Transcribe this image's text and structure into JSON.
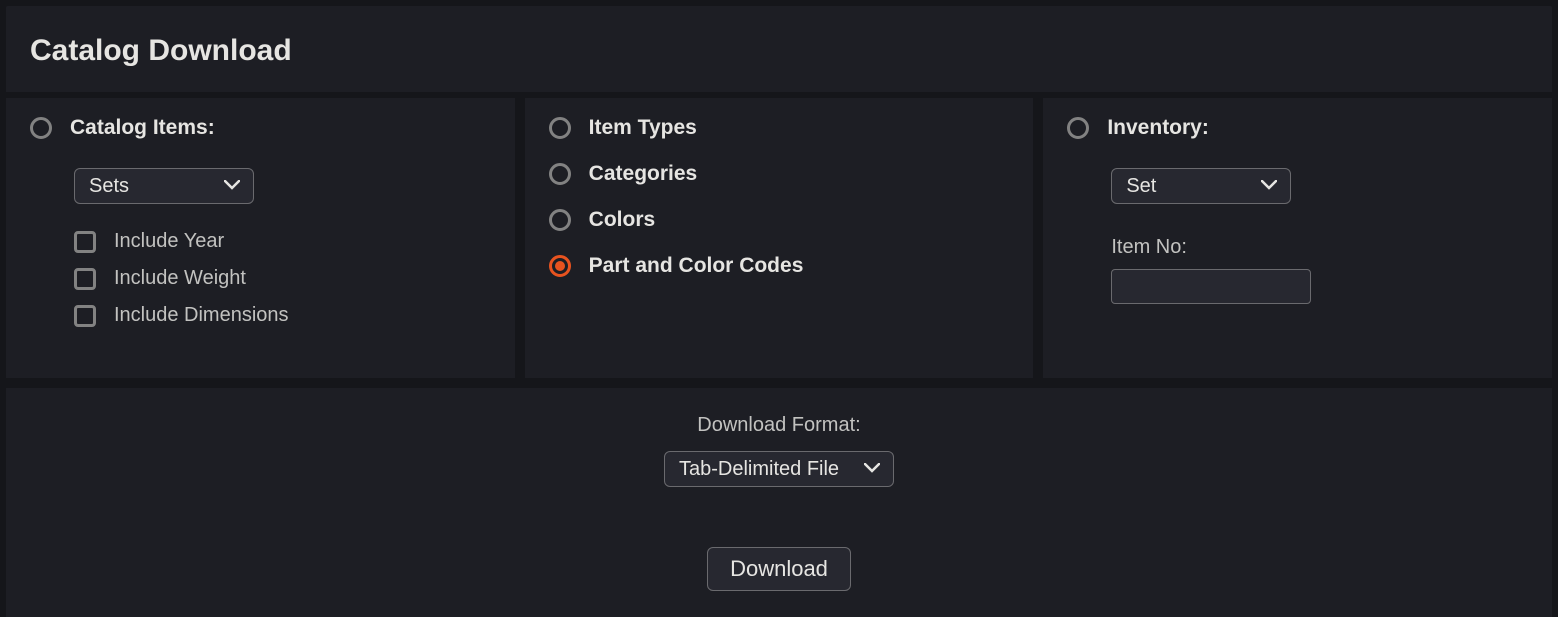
{
  "header": {
    "title": "Catalog Download"
  },
  "col1": {
    "radio_label": "Catalog Items:",
    "radio_selected": false,
    "select_value": "Sets",
    "checkboxes": [
      {
        "label": "Include Year",
        "checked": false
      },
      {
        "label": "Include Weight",
        "checked": false
      },
      {
        "label": "Include Dimensions",
        "checked": false
      }
    ]
  },
  "col2": {
    "options": [
      {
        "label": "Item Types",
        "selected": false
      },
      {
        "label": "Categories",
        "selected": false
      },
      {
        "label": "Colors",
        "selected": false
      },
      {
        "label": "Part and Color Codes",
        "selected": true
      }
    ]
  },
  "col3": {
    "radio_label": "Inventory:",
    "radio_selected": false,
    "select_value": "Set",
    "item_no_label": "Item No:",
    "item_no_value": ""
  },
  "footer": {
    "format_label": "Download Format:",
    "format_value": "Tab-Delimited File",
    "download_label": "Download"
  }
}
